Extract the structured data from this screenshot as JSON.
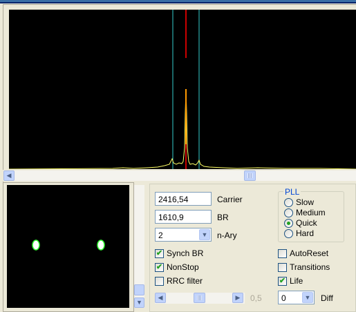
{
  "spectrum": {
    "colors": {
      "background": "#000000",
      "trace": "#ffff66",
      "peak": "#ff9900",
      "marker_center": "#cc0000",
      "marker_band": "#33cccc"
    }
  },
  "constellation": {
    "colors": {
      "background": "#000000",
      "point_fill": "#ffffff",
      "point_edge": "#33ff33"
    }
  },
  "fields": {
    "carrier": {
      "value": "2416,54",
      "label": "Carrier"
    },
    "br": {
      "value": "1610,9",
      "label": "BR"
    },
    "nary": {
      "value": "2",
      "label": "n-Ary"
    }
  },
  "pll": {
    "title": "PLL",
    "options": [
      {
        "label": "Slow",
        "selected": false
      },
      {
        "label": "Medium",
        "selected": false
      },
      {
        "label": "Quick",
        "selected": true
      },
      {
        "label": "Hard",
        "selected": false
      }
    ]
  },
  "checkboxes_left": [
    {
      "label": "Synch BR",
      "checked": true
    },
    {
      "label": "NonStop",
      "checked": true
    },
    {
      "label": "RRC filter",
      "checked": false
    }
  ],
  "checkboxes_right": [
    {
      "label": "AutoReset",
      "checked": false
    },
    {
      "label": "Transitions",
      "checked": false
    },
    {
      "label": "Life",
      "checked": true
    }
  ],
  "slider": {
    "readout": "0,5"
  },
  "diff": {
    "value": "0",
    "label": "Diff"
  },
  "icons": {
    "scroll_left": "◀",
    "scroll_right": "▶",
    "scroll_down": "▼",
    "combo_arrow": "▼",
    "check": "✔"
  }
}
